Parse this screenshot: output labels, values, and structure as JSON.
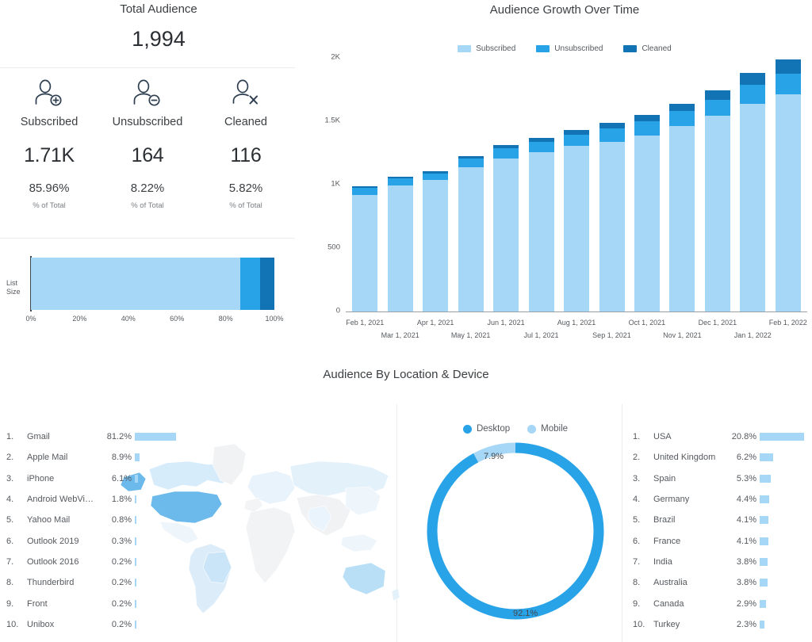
{
  "colors": {
    "subscribed": "#a6d7f6",
    "unsubscribed": "#29a3e8",
    "cleaned": "#1273b5",
    "icon": "#2d3e50",
    "text": "#3c4043",
    "muted": "#55595e",
    "rule": "#ececec",
    "map_land": "#f0f2f4",
    "map_low": "#e3f1fb",
    "map_mid": "#bfe0f7",
    "map_high": "#6cb9ec"
  },
  "kpi": {
    "title": "Total Audience",
    "total": "1,994",
    "columns": [
      {
        "icon": "user-plus-icon",
        "label": "Subscribed",
        "value": "1.71K",
        "percent": "85.96%",
        "sub": "% of Total"
      },
      {
        "icon": "user-minus-icon",
        "label": "Unsubscribed",
        "value": "164",
        "percent": "8.22%",
        "sub": "% of Total"
      },
      {
        "icon": "user-x-icon",
        "label": "Cleaned",
        "value": "116",
        "percent": "5.82%",
        "sub": "% of Total"
      }
    ]
  },
  "list_size": {
    "axis_label": "List\nSize",
    "axis_label_line1": "List",
    "axis_label_line2": "Size",
    "ticks": [
      "0%",
      "20%",
      "40%",
      "60%",
      "80%",
      "100%"
    ],
    "chart_data": {
      "type": "bar",
      "orientation": "horizontal",
      "title": "",
      "categories": [
        "List Size"
      ],
      "series": [
        {
          "name": "Subscribed",
          "values": [
            85.96
          ]
        },
        {
          "name": "Unsubscribed",
          "values": [
            8.22
          ]
        },
        {
          "name": "Cleaned",
          "values": [
            5.82
          ]
        }
      ],
      "xlabel": "",
      "ylabel": "",
      "xlim": [
        0,
        100
      ],
      "tick_labels": [
        "0%",
        "20%",
        "40%",
        "60%",
        "80%",
        "100%"
      ],
      "stacked": true,
      "grid": false,
      "legend": "none"
    }
  },
  "growth": {
    "title": "Audience Growth Over Time",
    "legend": [
      "Subscribed",
      "Unsubscribed",
      "Cleaned"
    ],
    "y_ticks": [
      "2K",
      "1.5K",
      "1K",
      "500",
      "0"
    ],
    "chart_data": {
      "type": "bar",
      "title": "Audience Growth Over Time",
      "stacked": true,
      "categories": [
        "Feb 1, 2021",
        "Mar 1, 2021",
        "Apr 1, 2021",
        "May 1, 2021",
        "Jun 1, 2021",
        "Jul 1, 2021",
        "Aug 1, 2021",
        "Sep 1, 2021",
        "Oct 1, 2021",
        "Nov 1, 2021",
        "Dec 1, 2021",
        "Jan 1, 2022",
        "Feb 1, 2022"
      ],
      "series": [
        {
          "name": "Subscribed",
          "values": [
            920,
            995,
            1040,
            1135,
            1205,
            1255,
            1305,
            1340,
            1390,
            1460,
            1545,
            1640,
            1710
          ]
        },
        {
          "name": "Unsubscribed",
          "values": [
            55,
            55,
            45,
            70,
            80,
            85,
            90,
            105,
            110,
            120,
            125,
            145,
            164
          ]
        },
        {
          "name": "Cleaned",
          "values": [
            10,
            12,
            20,
            22,
            25,
            30,
            35,
            40,
            50,
            60,
            75,
            95,
            116
          ]
        }
      ],
      "totals": [
        985,
        1062,
        1105,
        1227,
        1310,
        1370,
        1430,
        1485,
        1550,
        1640,
        1745,
        1880,
        1990
      ],
      "xlabel": "",
      "ylabel": "",
      "ylim": [
        0,
        2000
      ],
      "ytick_values": [
        0,
        500,
        1000,
        1500,
        2000
      ],
      "ytick_labels": [
        "0",
        "500",
        "1K",
        "1.5K",
        "2K"
      ],
      "grid": false,
      "legend": "top-center"
    }
  },
  "bottom": {
    "title": "Audience By Location & Device"
  },
  "email_clients": {
    "chart_data": {
      "type": "bar",
      "orientation": "horizontal",
      "title": "",
      "categories": [
        "Gmail",
        "Apple Mail",
        "iPhone",
        "Android WebVi...",
        "Yahoo Mail",
        "Outlook 2019",
        "Outlook 2016",
        "Thunderbird",
        "Front",
        "Unibox"
      ],
      "values": [
        81.2,
        8.9,
        6.1,
        1.8,
        0.8,
        0.3,
        0.2,
        0.2,
        0.2,
        0.2
      ],
      "value_labels": [
        "81.2%",
        "8.9%",
        "6.1%",
        "1.8%",
        "0.8%",
        "0.3%",
        "0.2%",
        "0.2%",
        "0.2%",
        "0.2%"
      ],
      "xlabel": "",
      "ylabel": "",
      "xlim": [
        0,
        81.2
      ],
      "grid": false,
      "legend": "none"
    },
    "rows": [
      {
        "rank": "1.",
        "name": "Gmail",
        "percent": "81.2%",
        "value": 81.2
      },
      {
        "rank": "2.",
        "name": "Apple Mail",
        "percent": "8.9%",
        "value": 8.9
      },
      {
        "rank": "3.",
        "name": "iPhone",
        "percent": "6.1%",
        "value": 6.1
      },
      {
        "rank": "4.",
        "name": "Android WebVi…",
        "percent": "1.8%",
        "value": 1.8
      },
      {
        "rank": "5.",
        "name": "Yahoo Mail",
        "percent": "0.8%",
        "value": 0.8
      },
      {
        "rank": "6.",
        "name": "Outlook 2019",
        "percent": "0.3%",
        "value": 0.3
      },
      {
        "rank": "7.",
        "name": "Outlook 2016",
        "percent": "0.2%",
        "value": 0.2
      },
      {
        "rank": "8.",
        "name": "Thunderbird",
        "percent": "0.2%",
        "value": 0.2
      },
      {
        "rank": "9.",
        "name": "Front",
        "percent": "0.2%",
        "value": 0.2
      },
      {
        "rank": "10.",
        "name": "Unibox",
        "percent": "0.2%",
        "value": 0.2
      }
    ]
  },
  "countries": {
    "chart_data": {
      "type": "bar",
      "orientation": "horizontal",
      "title": "",
      "categories": [
        "USA",
        "United Kingdom",
        "Spain",
        "Germany",
        "Brazil",
        "France",
        "India",
        "Australia",
        "Canada",
        "Turkey"
      ],
      "values": [
        20.8,
        6.2,
        5.3,
        4.4,
        4.1,
        4.1,
        3.8,
        3.8,
        2.9,
        2.3
      ],
      "value_labels": [
        "20.8%",
        "6.2%",
        "5.3%",
        "4.4%",
        "4.1%",
        "4.1%",
        "3.8%",
        "3.8%",
        "2.9%",
        "2.3%"
      ],
      "xlabel": "",
      "ylabel": "",
      "xlim": [
        0,
        20.8
      ],
      "grid": false,
      "legend": "none"
    },
    "rows": [
      {
        "rank": "1.",
        "name": "USA",
        "percent": "20.8%",
        "value": 20.8
      },
      {
        "rank": "2.",
        "name": "United Kingdom",
        "percent": "6.2%",
        "value": 6.2
      },
      {
        "rank": "3.",
        "name": "Spain",
        "percent": "5.3%",
        "value": 5.3
      },
      {
        "rank": "4.",
        "name": "Germany",
        "percent": "4.4%",
        "value": 4.4
      },
      {
        "rank": "5.",
        "name": "Brazil",
        "percent": "4.1%",
        "value": 4.1
      },
      {
        "rank": "6.",
        "name": "France",
        "percent": "4.1%",
        "value": 4.1
      },
      {
        "rank": "7.",
        "name": "India",
        "percent": "3.8%",
        "value": 3.8
      },
      {
        "rank": "8.",
        "name": "Australia",
        "percent": "3.8%",
        "value": 3.8
      },
      {
        "rank": "9.",
        "name": "Canada",
        "percent": "2.9%",
        "value": 2.9
      },
      {
        "rank": "10.",
        "name": "Turkey",
        "percent": "2.3%",
        "value": 2.3
      }
    ]
  },
  "device": {
    "legend": [
      "Desktop",
      "Mobile"
    ],
    "label_mobile": "7.9%",
    "label_desktop": "92.1%",
    "chart_data": {
      "type": "pie",
      "subtype": "donut",
      "title": "",
      "categories": [
        "Desktop",
        "Mobile"
      ],
      "values": [
        92.1,
        7.9
      ],
      "value_labels": [
        "92.1%",
        "7.9%"
      ],
      "colors": [
        "#29a3e8",
        "#a6d7f6"
      ],
      "legend": "top-center",
      "grid": false
    }
  }
}
